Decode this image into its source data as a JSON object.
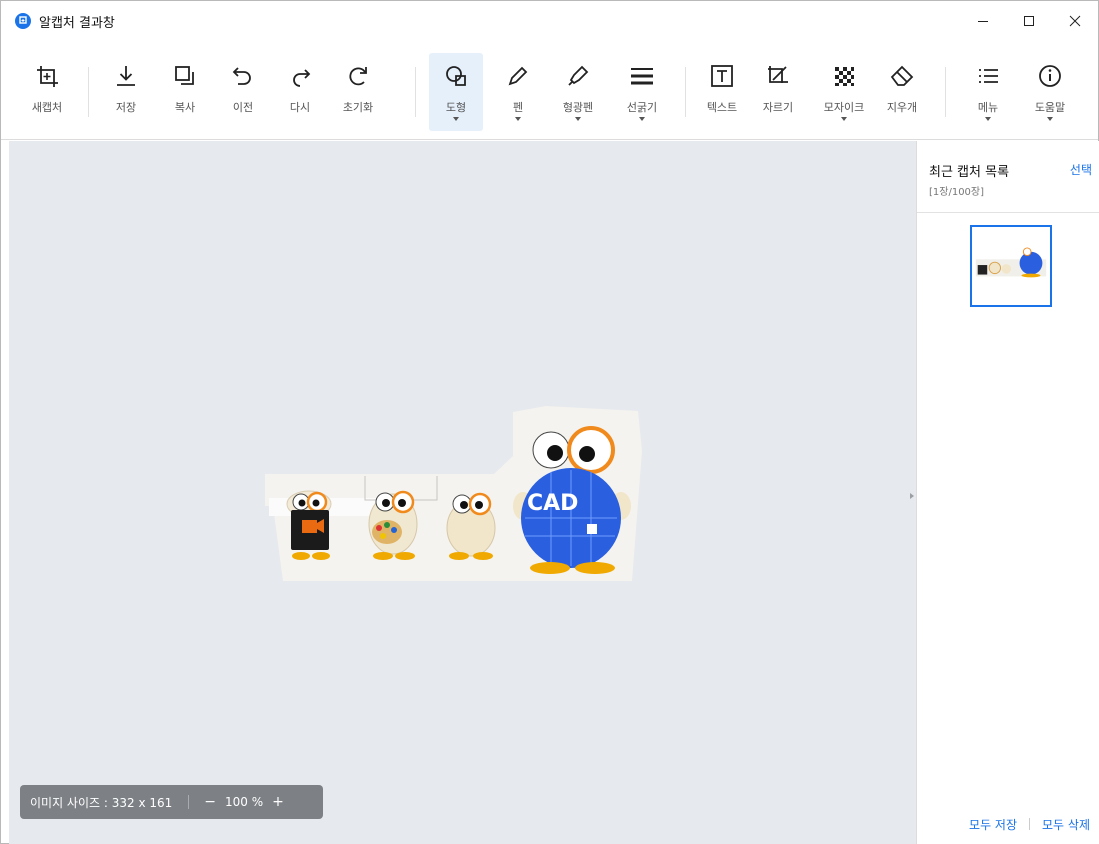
{
  "window": {
    "title": "알캡처 결과창",
    "controls": [
      "minimize",
      "maximize",
      "close"
    ]
  },
  "toolbar": {
    "items": [
      {
        "label": "새캡처",
        "icon": "new-capture-icon",
        "dropdown": false
      },
      {
        "label": "저장",
        "icon": "download-icon",
        "dropdown": false
      },
      {
        "label": "복사",
        "icon": "copy-icon",
        "dropdown": false
      },
      {
        "label": "이전",
        "icon": "undo-icon",
        "dropdown": false
      },
      {
        "label": "다시",
        "icon": "redo-icon",
        "dropdown": false
      },
      {
        "label": "초기화",
        "icon": "reset-icon",
        "dropdown": false
      },
      {
        "label": "도형",
        "icon": "shape-icon",
        "dropdown": true,
        "active": true
      },
      {
        "label": "펜",
        "icon": "pen-icon",
        "dropdown": true
      },
      {
        "label": "형광펜",
        "icon": "highlighter-icon",
        "dropdown": true
      },
      {
        "label": "선굵기",
        "icon": "line-width-icon",
        "dropdown": true
      },
      {
        "label": "텍스트",
        "icon": "text-icon",
        "dropdown": false
      },
      {
        "label": "자르기",
        "icon": "crop-icon",
        "dropdown": false
      },
      {
        "label": "모자이크",
        "icon": "mosaic-icon",
        "dropdown": true
      },
      {
        "label": "지우개",
        "icon": "eraser-icon",
        "dropdown": false
      },
      {
        "label": "메뉴",
        "icon": "menu-icon",
        "dropdown": true
      },
      {
        "label": "도움말",
        "icon": "info-icon",
        "dropdown": true
      }
    ]
  },
  "canvas": {
    "image_size_label": "이미지 사이즈 : 332 x 161",
    "zoom_out": "−",
    "zoom_value": "100 %",
    "zoom_in": "+",
    "captured_image": {
      "badge_text": "CAD"
    }
  },
  "side_panel": {
    "title": "최근 캡처 목록",
    "count": "[1장/100장]",
    "select_label": "선택",
    "save_all": "모두 저장",
    "delete_all": "모두 삭제"
  },
  "colors": {
    "accent": "#1a73e8",
    "canvas_bg": "#e6e9ee",
    "active_tool_bg": "#e6f0fb",
    "size_bar_bg": "#7d8185"
  }
}
